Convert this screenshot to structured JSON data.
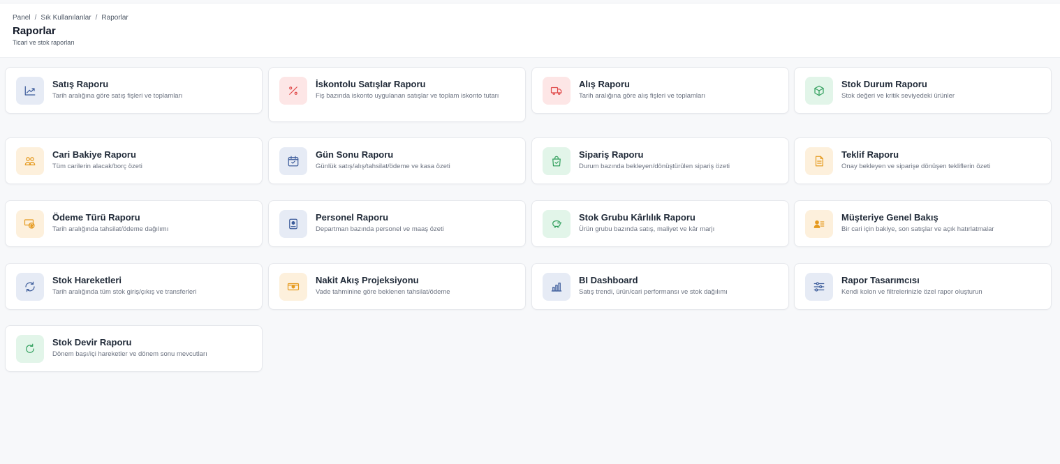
{
  "breadcrumb": {
    "items": [
      "Panel",
      "Sık Kullanılanlar",
      "Raporlar"
    ],
    "separator": "/"
  },
  "header": {
    "title": "Raporlar",
    "subtitle": "Ticari ve stok raporları"
  },
  "colors": {
    "blue": "#3b5b9a",
    "red": "#e04848",
    "green": "#2f9e5b",
    "orange": "#e59a1f"
  },
  "reports": [
    {
      "title": "Satış Raporu",
      "desc": "Tarih aralığına göre satış fişleri ve toplamları",
      "icon": "trend-chart-icon",
      "color": "blue"
    },
    {
      "title": "İskontolu Satışlar Raporu",
      "desc": "Fiş bazında iskonto uygulanan satışlar ve toplam iskonto tutarı",
      "icon": "percent-icon",
      "color": "red"
    },
    {
      "title": "Alış Raporu",
      "desc": "Tarih aralığına göre alış fişleri ve toplamları",
      "icon": "truck-icon",
      "color": "red"
    },
    {
      "title": "Stok Durum Raporu",
      "desc": "Stok değeri ve kritik seviyedeki ürünler",
      "icon": "box-icon",
      "color": "green"
    },
    {
      "title": "Cari Bakiye Raporu",
      "desc": "Tüm carilerin alacak/borç özeti",
      "icon": "users-icon",
      "color": "orange"
    },
    {
      "title": "Gün Sonu Raporu",
      "desc": "Günlük satış/alış/tahsilat/ödeme ve kasa özeti",
      "icon": "calendar-check-icon",
      "color": "blue"
    },
    {
      "title": "Sipariş Raporu",
      "desc": "Durum bazında bekleyen/dönüştürülen sipariş özeti",
      "icon": "shopping-bag-check-icon",
      "color": "green"
    },
    {
      "title": "Teklif Raporu",
      "desc": "Onay bekleyen ve siparişe dönüşen tekliflerin özeti",
      "icon": "document-icon",
      "color": "orange"
    },
    {
      "title": "Ödeme Türü Raporu",
      "desc": "Tarih aralığında tahsilat/ödeme dağılımı",
      "icon": "money-exchange-icon",
      "color": "orange"
    },
    {
      "title": "Personel Raporu",
      "desc": "Departman bazında personel ve maaş özeti",
      "icon": "id-badge-icon",
      "color": "blue"
    },
    {
      "title": "Stok Grubu Kârlılık Raporu",
      "desc": "Ürün grubu bazında satış, maliyet ve kâr marjı",
      "icon": "piggy-bank-icon",
      "color": "green"
    },
    {
      "title": "Müşteriye Genel Bakış",
      "desc": "Bir cari için bakiye, son satışlar ve açık hatırlatmalar",
      "icon": "user-list-icon",
      "color": "orange"
    },
    {
      "title": "Stok Hareketleri",
      "desc": "Tarih aralığında tüm stok giriş/çıkış ve transferleri",
      "icon": "refresh-icon",
      "color": "blue"
    },
    {
      "title": "Nakit Akış Projeksiyonu",
      "desc": "Vade tahminine göre beklenen tahsilat/ödeme",
      "icon": "cash-icon",
      "color": "orange"
    },
    {
      "title": "BI Dashboard",
      "desc": "Satış trendi, ürün/cari performansı ve stok dağılımı",
      "icon": "bar-chart-icon",
      "color": "blue"
    },
    {
      "title": "Rapor Tasarımcısı",
      "desc": "Kendi kolon ve filtrelerinizle özel rapor oluşturun",
      "icon": "sliders-icon",
      "color": "blue"
    },
    {
      "title": "Stok Devir Raporu",
      "desc": "Dönem başı/içi hareketler ve dönem sonu mevcutları",
      "icon": "rotate-icon",
      "color": "green"
    }
  ]
}
